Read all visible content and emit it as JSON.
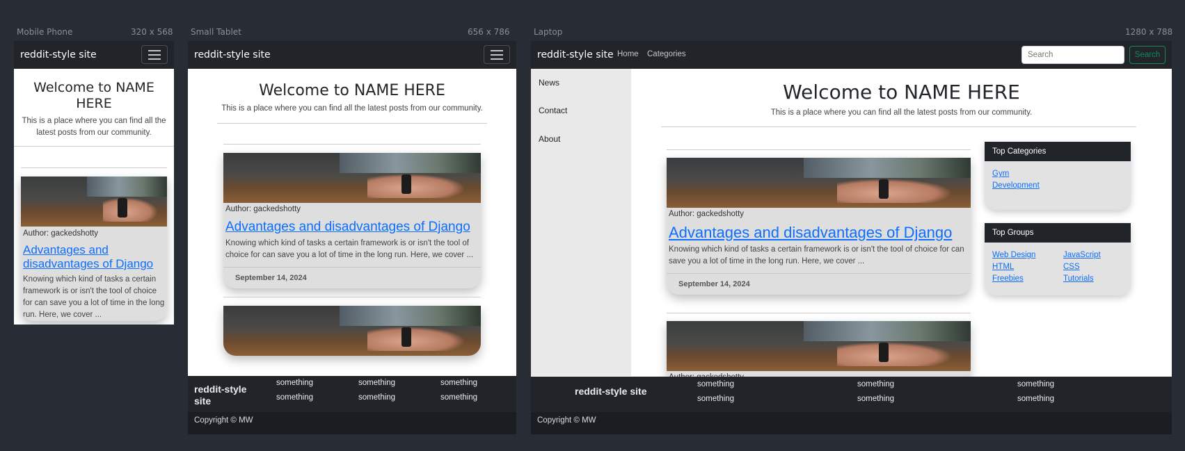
{
  "devices": {
    "mobile": {
      "name": "Mobile Phone",
      "size": "320 x 568"
    },
    "tablet": {
      "name": "Small Tablet",
      "size": "656 x 786"
    },
    "laptop": {
      "name": "Laptop",
      "size": "1280 x 788"
    }
  },
  "site": {
    "brand": "reddit-style site",
    "footer_brand": "reddit-style site",
    "copyright": "Copyright © MW"
  },
  "nav": {
    "links": [
      "Home",
      "Categories"
    ],
    "search_placeholder": "Search",
    "search_button": "Search"
  },
  "hero": {
    "title": "Welcome to NAME HERE",
    "subtitle": "This is a place where you can find all the latest posts from our community."
  },
  "sidebar": {
    "items": [
      "News",
      "Contact",
      "About"
    ]
  },
  "post": {
    "author": "Author: gackedshotty",
    "title": "Advantages and disadvantages of Django",
    "excerpt": "Knowing which kind of tasks a certain framework is or isn't the tool of choice for can save you a lot of time in the long run. Here, we cover ...",
    "date": "September 14, 2024",
    "author_partial": "Author: gackedshotty"
  },
  "widgets": {
    "top_categories": {
      "title": "Top Categories",
      "items": [
        "Gym",
        "Development"
      ]
    },
    "top_groups": {
      "title": "Top Groups",
      "items": [
        "Web Design",
        "JavaScript",
        "HTML",
        "CSS",
        "Freebies",
        "Tutorials"
      ]
    }
  },
  "footer": {
    "items": [
      "something",
      "something",
      "something",
      "something",
      "something",
      "something"
    ]
  },
  "colors": {
    "background": "#282c34",
    "navbar": "#212529",
    "link": "#0d6efd",
    "search_button": "#198754"
  },
  "icons": {
    "menu": "hamburger-icon"
  }
}
